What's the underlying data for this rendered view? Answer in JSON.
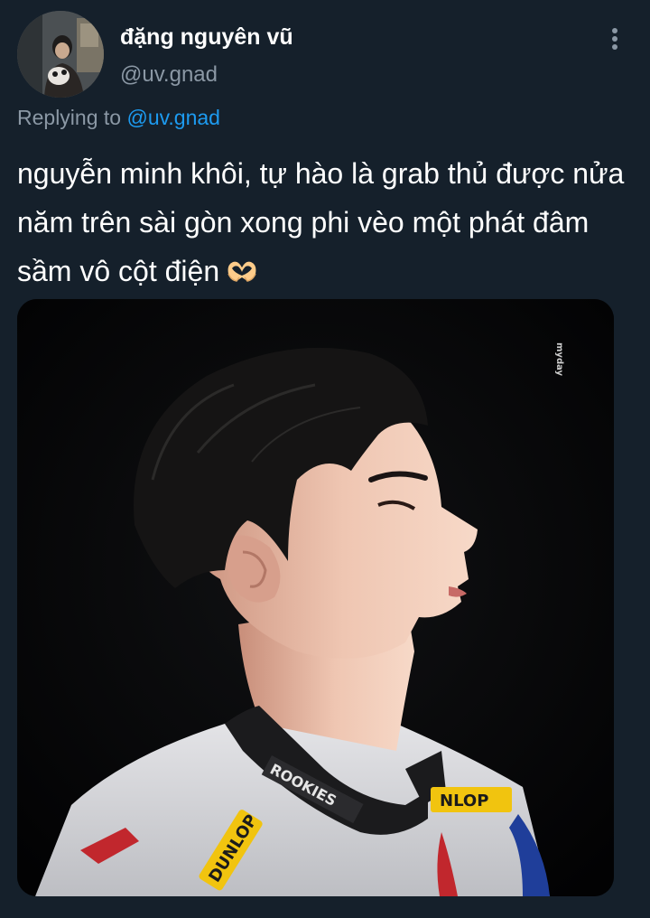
{
  "user": {
    "display_name": "đặng nguyên vũ",
    "handle": "@uv.gnad"
  },
  "reply_context": {
    "prefix": "Replying to",
    "mention": "@uv.gnad"
  },
  "tweet": {
    "text": "nguyễn minh khôi, tự hào là grab thủ được nửa\nnăm trên sài gòn xong phi vèo một phát đâm\nsầm vô cột điện",
    "emoji_icon": "heart-hands-emoji"
  },
  "media": {
    "kind": "photo",
    "watermark": "myday",
    "jersey_text": [
      "ROOKIES",
      "DUNLOP",
      "NLOP"
    ]
  },
  "icons": {
    "more": "vertical-ellipsis-icon"
  },
  "colors": {
    "background": "#15202b",
    "primary_text": "#ffffff",
    "secondary_text": "#8b98a5",
    "link": "#1d9bf0"
  }
}
